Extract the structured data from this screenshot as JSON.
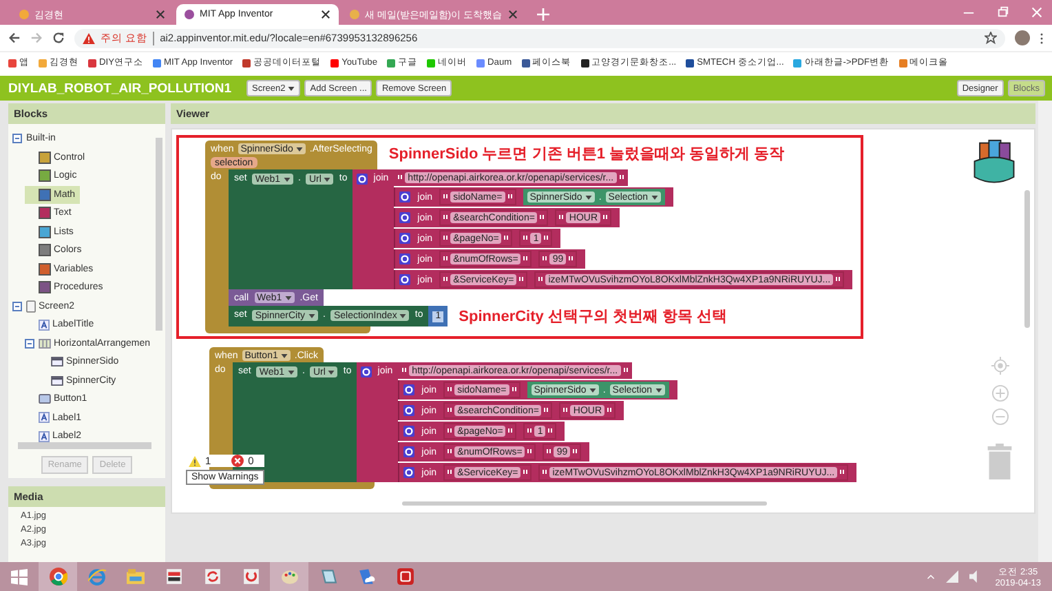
{
  "browser": {
    "tabs": [
      {
        "title": "김경현",
        "selected": false,
        "color": "#f2a93b"
      },
      {
        "title": "MIT App Inventor",
        "selected": true,
        "color": "#9b4f9e"
      },
      {
        "title": "새 메일(받은메일함)이 도착했습",
        "selected": false,
        "color": "#e8b04a"
      }
    ],
    "address": {
      "warning": "주의 요함",
      "url": "ai2.appinventor.mit.edu/?locale=en#6739953132896256"
    },
    "bookmarks": [
      {
        "label": "앱",
        "color": "#e8453c"
      },
      {
        "label": "김경현",
        "color": "#f2a93b"
      },
      {
        "label": "DIY연구소",
        "color": "#d9363e"
      },
      {
        "label": "MIT App Inventor",
        "color": "#4285f4"
      },
      {
        "label": "공공데이터포털",
        "color": "#c0392b"
      },
      {
        "label": "YouTube",
        "color": "#ff0000"
      },
      {
        "label": "구글",
        "color": "#34a853"
      },
      {
        "label": "네이버",
        "color": "#1ec800"
      },
      {
        "label": "Daum",
        "color": "#6b8cff"
      },
      {
        "label": "페이스북",
        "color": "#3b5998"
      },
      {
        "label": "고양경기문화창조...",
        "color": "#222222"
      },
      {
        "label": "SMTECH 중소기업...",
        "color": "#1f4e9c"
      },
      {
        "label": "아래한글->PDF변환",
        "color": "#29a8e0"
      },
      {
        "label": "메이크올",
        "color": "#e67e22"
      }
    ]
  },
  "app": {
    "title": "DIYLAB_ROBOT_AIR_POLLUTION1",
    "screen_button": "Screen2",
    "add_screen": "Add Screen ...",
    "remove_screen": "Remove Screen",
    "views": [
      {
        "label": "Designer",
        "selected": false
      },
      {
        "label": "Blocks",
        "selected": true
      }
    ]
  },
  "blocks_panel": {
    "title": "Blocks",
    "tree": [
      {
        "label": "Built-in",
        "kind": "group",
        "expanded": true,
        "selected": false,
        "children": [
          {
            "label": "Control",
            "kind": "category",
            "color": "#c8a23a",
            "selected": false
          },
          {
            "label": "Logic",
            "kind": "category",
            "color": "#77ab41",
            "selected": false
          },
          {
            "label": "Math",
            "kind": "category",
            "color": "#3f71b5",
            "selected": true
          },
          {
            "label": "Text",
            "kind": "category",
            "color": "#b32d5e",
            "selected": false
          },
          {
            "label": "Lists",
            "kind": "category",
            "color": "#49a6d4",
            "selected": false
          },
          {
            "label": "Colors",
            "kind": "category",
            "color": "#7d7d7d",
            "selected": false
          },
          {
            "label": "Variables",
            "kind": "category",
            "color": "#d05f2d",
            "selected": false
          },
          {
            "label": "Procedures",
            "kind": "category",
            "color": "#7c5385",
            "selected": false
          }
        ]
      },
      {
        "label": "Screen2",
        "kind": "screen",
        "expanded": true,
        "selected": false,
        "children": [
          {
            "label": "LabelTitle",
            "kind": "label",
            "selected": false
          },
          {
            "label": "HorizontalArrangemen",
            "kind": "arrangement",
            "expanded": true,
            "selected": false,
            "children": [
              {
                "label": "SpinnerSido",
                "kind": "spinner",
                "selected": false
              },
              {
                "label": "SpinnerCity",
                "kind": "spinner",
                "selected": false
              }
            ]
          },
          {
            "label": "Button1",
            "kind": "button",
            "selected": false
          },
          {
            "label": "Label1",
            "kind": "label",
            "selected": false
          },
          {
            "label": "Label2",
            "kind": "label",
            "selected": false
          }
        ]
      }
    ],
    "buttons": [
      {
        "label": "Rename",
        "disabled": true
      },
      {
        "label": "Delete",
        "disabled": true
      }
    ]
  },
  "viewer": {
    "title": "Viewer",
    "event_blocks": [
      {
        "when": "when",
        "component": "SpinnerSido",
        "event": ".AfterSelecting",
        "parameter": "selection",
        "do": "do",
        "note": "SpinnerSido 누르면 기존 버튼1 눌렀을때와 동일하게 동작",
        "statements": [
          {
            "kind": "set",
            "label": "set",
            "component": "Web1",
            "dot": ".",
            "property": "Url",
            "to": "to",
            "value": {
              "kind": "join",
              "label": "join",
              "items": [
                {
                  "kind": "text",
                  "text": "http://openapi.airkorea.or.kr/openapi/services/r..."
                },
                {
                  "kind": "join",
                  "label": "join",
                  "items": [
                    {
                      "kind": "text",
                      "text": "sidoName="
                    },
                    {
                      "kind": "getter",
                      "component": "SpinnerSido",
                      "dot": ".",
                      "property": "Selection"
                    }
                  ]
                },
                {
                  "kind": "join",
                  "label": "join",
                  "items": [
                    {
                      "kind": "text",
                      "text": "&searchCondition="
                    },
                    {
                      "kind": "text",
                      "text": "HOUR"
                    }
                  ]
                },
                {
                  "kind": "join",
                  "label": "join",
                  "items": [
                    {
                      "kind": "text",
                      "text": "&pageNo="
                    },
                    {
                      "kind": "text",
                      "text": "1"
                    }
                  ]
                },
                {
                  "kind": "join",
                  "label": "join",
                  "items": [
                    {
                      "kind": "text",
                      "text": "&numOfRows="
                    },
                    {
                      "kind": "text",
                      "text": "99"
                    }
                  ]
                },
                {
                  "kind": "join",
                  "label": "join",
                  "items": [
                    {
                      "kind": "text",
                      "text": "&ServiceKey="
                    },
                    {
                      "kind": "text",
                      "text": "izeMTwOVuSvihzmOYoL8OKxlMblZnkH3Qw4XP1a9NRiRUYUJ..."
                    }
                  ]
                }
              ]
            }
          },
          {
            "kind": "call",
            "label": "call",
            "component": "Web1",
            "method": ".Get"
          },
          {
            "kind": "set",
            "label": "set",
            "component": "SpinnerCity",
            "dot": ".",
            "property": "SelectionIndex",
            "to": "to",
            "value": {
              "kind": "number",
              "text": "1"
            },
            "note": "SpinnerCity 선택구의 첫번째 항목 선택"
          }
        ]
      },
      {
        "when": "when",
        "component": "Button1",
        "event": ".Click",
        "do": "do",
        "statements": [
          {
            "kind": "set",
            "label": "set",
            "component": "Web1",
            "dot": ".",
            "property": "Url",
            "to": "to",
            "value": {
              "kind": "join",
              "label": "join",
              "items": [
                {
                  "kind": "text",
                  "text": "http://openapi.airkorea.or.kr/openapi/services/r..."
                },
                {
                  "kind": "join",
                  "label": "join",
                  "items": [
                    {
                      "kind": "text",
                      "text": "sidoName="
                    },
                    {
                      "kind": "getter",
                      "component": "SpinnerSido",
                      "dot": ".",
                      "property": "Selection"
                    }
                  ]
                },
                {
                  "kind": "join",
                  "label": "join",
                  "items": [
                    {
                      "kind": "text",
                      "text": "&searchCondition="
                    },
                    {
                      "kind": "text",
                      "text": "HOUR"
                    }
                  ]
                },
                {
                  "kind": "join",
                  "label": "join",
                  "items": [
                    {
                      "kind": "text",
                      "text": "&pageNo="
                    },
                    {
                      "kind": "text",
                      "text": "1"
                    }
                  ]
                },
                {
                  "kind": "join",
                  "label": "join",
                  "items": [
                    {
                      "kind": "text",
                      "text": "&numOfRows="
                    },
                    {
                      "kind": "text",
                      "text": "99"
                    }
                  ]
                },
                {
                  "kind": "join",
                  "label": "join",
                  "items": [
                    {
                      "kind": "text",
                      "text": "&ServiceKey="
                    },
                    {
                      "kind": "text",
                      "text": "izeMTwOVuSvihzmOYoL8OKxlMblZnkH3Qw4XP1a9NRiRUYUJ..."
                    }
                  ]
                }
              ]
            }
          }
        ]
      }
    ],
    "warnings": {
      "warning_count": "1",
      "error_count": "0",
      "toggle": "Show Warnings"
    }
  },
  "media": {
    "title": "Media",
    "files": [
      "A1.jpg",
      "A2.jpg",
      "A3.jpg"
    ]
  },
  "taskbar": {
    "apps": [
      {
        "kind": "start",
        "selected": false
      },
      {
        "kind": "chrome",
        "selected": true
      },
      {
        "kind": "ie",
        "selected": false
      },
      {
        "kind": "folder",
        "selected": false
      },
      {
        "kind": "toggle",
        "selected": false
      },
      {
        "kind": "sync",
        "selected": false
      },
      {
        "kind": "restart",
        "selected": false
      },
      {
        "kind": "paint",
        "selected": true
      },
      {
        "kind": "notes",
        "selected": false
      },
      {
        "kind": "cloud",
        "selected": false
      },
      {
        "kind": "red",
        "selected": false
      }
    ],
    "time": "오전 2:35",
    "date": "2019-04-13"
  }
}
